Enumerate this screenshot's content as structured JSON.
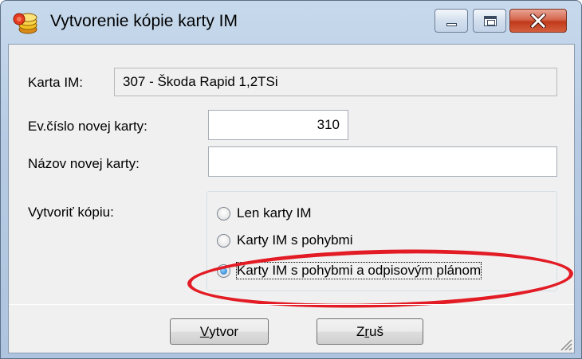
{
  "window": {
    "title": "Vytvorenie kópie karty IM",
    "controls": {
      "minimize": "minimize",
      "maximize": "maximize",
      "close": "close"
    }
  },
  "form": {
    "karta_label": "Karta IM:",
    "karta_value": "307 - Škoda Rapid 1,2TSi",
    "evcislo_label": "Ev.číslo novej karty:",
    "evcislo_value": "310",
    "nazov_label": "Názov novej karty:",
    "nazov_value": "",
    "copy_label": "Vytvoriť kópiu:"
  },
  "options": [
    {
      "label": "Len karty IM",
      "checked": false
    },
    {
      "label": "Karty IM s pohybmi",
      "checked": false
    },
    {
      "label": "Karty IM s pohybmi a odpisovým plánom",
      "checked": true
    }
  ],
  "buttons": {
    "create_mnemonic": "V",
    "create_rest": "ytvor",
    "cancel_start": "Z",
    "cancel_mnemonic": "r",
    "cancel_rest": "uš"
  },
  "colors": {
    "highlight": "#e21b24",
    "title_bar": "#b6cbe3",
    "close_button": "#c0391b"
  }
}
